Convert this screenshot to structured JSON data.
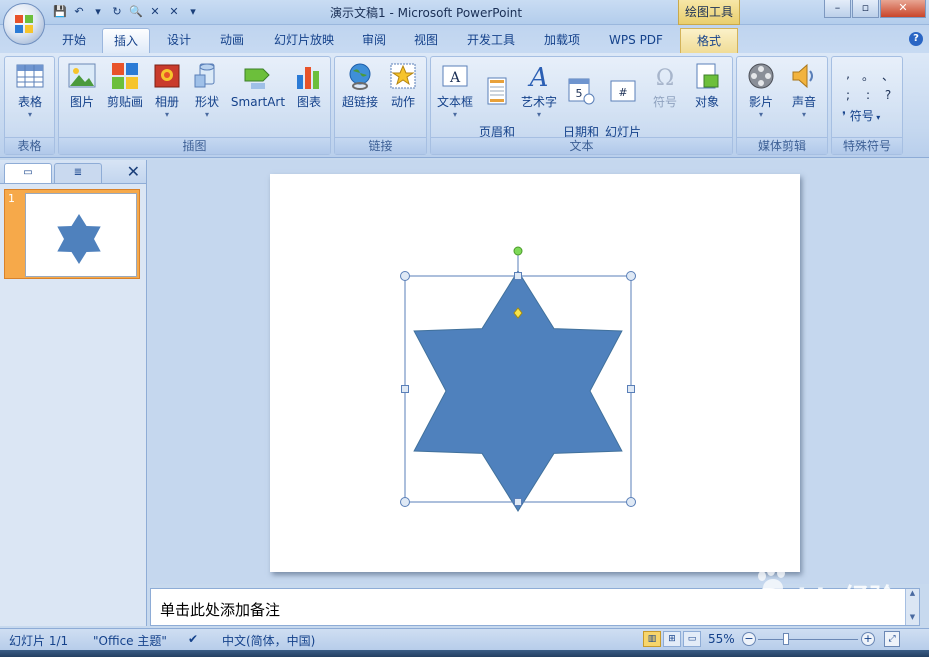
{
  "window": {
    "title": "演示文稿1 - Microsoft PowerPoint",
    "context_tab_title": "绘图工具",
    "controls": [
      "–",
      "▫",
      "✕"
    ]
  },
  "quick_access": [
    "save-icon",
    "undo-icon",
    "redo-icon",
    "preview-icon",
    "close-icon",
    "close-icon",
    "dropdown-icon"
  ],
  "tabs": [
    {
      "label": "开始"
    },
    {
      "label": "插入"
    },
    {
      "label": "设计"
    },
    {
      "label": "动画"
    },
    {
      "label": "幻灯片放映"
    },
    {
      "label": "审阅"
    },
    {
      "label": "视图"
    },
    {
      "label": "开发工具"
    },
    {
      "label": "加载项"
    },
    {
      "label": "WPS PDF"
    },
    {
      "label": "格式"
    }
  ],
  "active_tab": "插入",
  "ribbon": {
    "groups": [
      {
        "label": "表格",
        "buttons": [
          {
            "label": "表格"
          }
        ]
      },
      {
        "label": "插图",
        "buttons": [
          {
            "label": "图片"
          },
          {
            "label": "剪贴画"
          },
          {
            "label": "相册"
          },
          {
            "label": "形状"
          },
          {
            "label": "SmartArt"
          },
          {
            "label": "图表"
          }
        ]
      },
      {
        "label": "链接",
        "buttons": [
          {
            "label": "超链接"
          },
          {
            "label": "动作"
          }
        ]
      },
      {
        "label": "文本",
        "buttons": [
          {
            "label": "文本框"
          },
          {
            "label": "页眉和\n页脚"
          },
          {
            "label": "艺术字"
          },
          {
            "label": "日期和\n时间"
          },
          {
            "label": "幻灯片\n编号"
          },
          {
            "label": "符号"
          },
          {
            "label": "对象"
          }
        ]
      },
      {
        "label": "媒体剪辑",
        "buttons": [
          {
            "label": "影片"
          },
          {
            "label": "声音"
          }
        ]
      },
      {
        "label": "特殊符号",
        "buttons": [
          {
            "label": "符号"
          }
        ]
      }
    ],
    "special_symbols": [
      ",",
      "。",
      "、",
      ";",
      ":",
      "?"
    ]
  },
  "slides_pane": {
    "slide_number": "1"
  },
  "notes": {
    "placeholder": "单击此处添加备注"
  },
  "statusbar": {
    "slide_info": "幻灯片 1/1",
    "theme": "\"Office 主题\"",
    "language": "中文(简体，中国)",
    "zoom": "55%"
  },
  "watermark": {
    "text": "Baidu经验",
    "sub": "jingyan.baidu.com"
  },
  "colors": {
    "star_fill": "#4f81bd",
    "star_stroke": "#41719c",
    "handle_fill": "#ffffff",
    "rotation_handle": "#7ed957",
    "adjust_handle": "#f7e34a"
  }
}
